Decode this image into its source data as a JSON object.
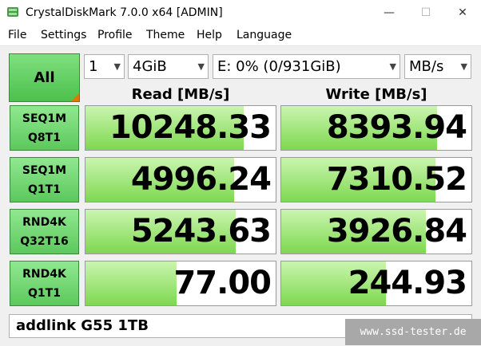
{
  "window": {
    "title": "CrystalDiskMark 7.0.0 x64 [ADMIN]",
    "minimize_glyph": "—",
    "maximize_glyph": "☐",
    "close_glyph": "✕"
  },
  "menu": [
    "File",
    "Settings",
    "Profile",
    "Theme",
    "Help",
    "Language"
  ],
  "controls": {
    "all_label": "All",
    "count": "1",
    "size": "4GiB",
    "drive": "E: 0% (0/931GiB)",
    "unit": "MB/s"
  },
  "headers": {
    "read": "Read [MB/s]",
    "write": "Write [MB/s]"
  },
  "rows": [
    {
      "line1": "SEQ1M",
      "line2": "Q8T1",
      "read": "10248.33",
      "write": "8393.94",
      "read_fill": 0.83,
      "write_fill": 0.82
    },
    {
      "line1": "SEQ1M",
      "line2": "Q1T1",
      "read": "4996.24",
      "write": "7310.52",
      "read_fill": 0.78,
      "write_fill": 0.81
    },
    {
      "line1": "RND4K",
      "line2": "Q32T16",
      "read": "5243.63",
      "write": "3926.84",
      "read_fill": 0.79,
      "write_fill": 0.76
    },
    {
      "line1": "RND4K",
      "line2": "Q1T1",
      "read": "77.00",
      "write": "244.93",
      "read_fill": 0.48,
      "write_fill": 0.55
    }
  ],
  "comment": "addlink G55 1TB",
  "watermark": "www.ssd-tester.de",
  "colors": {
    "accent_green": "#4cc04c",
    "bar_green": "#7ed84f",
    "corner_orange": "#e07800"
  }
}
